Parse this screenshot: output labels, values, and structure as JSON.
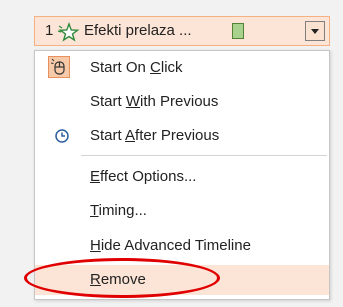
{
  "effect": {
    "number": "1",
    "name": "Efekti prelaza ...",
    "icon": "effect-star-icon",
    "timeline_color": "#a9d18e"
  },
  "menu": {
    "items": [
      {
        "label_pre": "Start On ",
        "accel": "C",
        "label_post": "lick",
        "icon": "mouse-click-icon"
      },
      {
        "label_pre": "Start ",
        "accel": "W",
        "label_post": "ith Previous",
        "icon": ""
      },
      {
        "label_pre": "Start ",
        "accel": "A",
        "label_post": "fter Previous",
        "icon": "clock-icon"
      },
      {
        "label_pre": "",
        "accel": "E",
        "label_post": "ffect Options...",
        "icon": ""
      },
      {
        "label_pre": "",
        "accel": "T",
        "label_post": "iming...",
        "icon": ""
      },
      {
        "label_pre": "",
        "accel": "H",
        "label_post": "ide Advanced Timeline",
        "icon": ""
      },
      {
        "label_pre": "",
        "accel": "R",
        "label_post": "emove",
        "icon": ""
      }
    ]
  },
  "colors": {
    "accent": "#f4b183",
    "highlight": "#fce4d6",
    "annotation": "#e00000"
  }
}
